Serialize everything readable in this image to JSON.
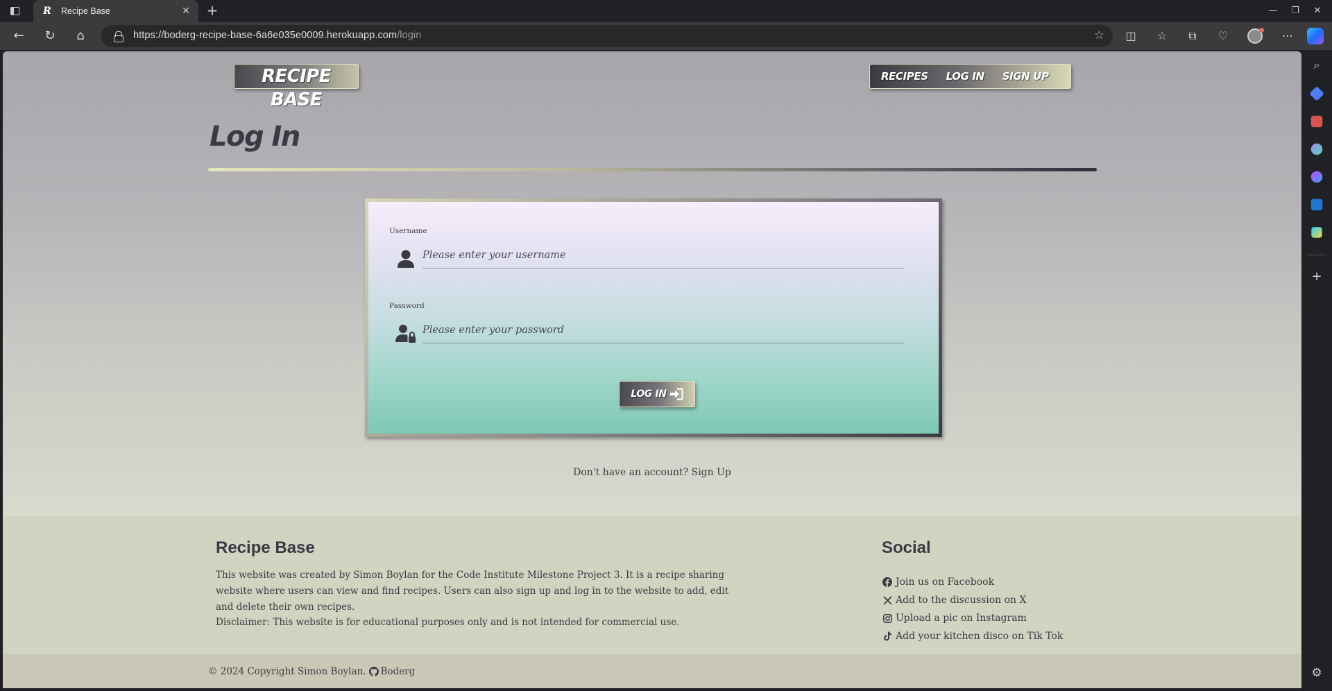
{
  "browser": {
    "tab_title": "Recipe Base",
    "tab_favicon": "R",
    "url_host": "https://boderg-recipe-base-6a6e035e0009.herokuapp.com",
    "url_path": "/login"
  },
  "site": {
    "logo": "RECIPE BASE",
    "nav": [
      {
        "label": "RECIPES"
      },
      {
        "label": "LOG IN"
      },
      {
        "label": "SIGN UP"
      }
    ]
  },
  "page": {
    "title": "Log In"
  },
  "form": {
    "username_label": "Username",
    "username_placeholder": "Please enter your username",
    "username_value": "",
    "password_label": "Password",
    "password_placeholder": "Please enter your password",
    "password_value": "",
    "submit_label": "LOG IN",
    "submit_icon": "sign-in-icon"
  },
  "signup": {
    "prompt": "Don't have an account?",
    "link": "Sign Up"
  },
  "footer": {
    "about_heading": "Recipe Base",
    "about_text": "This website was created by Simon Boylan for the Code Institute Milestone Project 3. It is a recipe sharing website where users can view and find recipes. Users can also sign up and log in to the website to add, edit and delete their own recipes.",
    "disclaimer": "Disclaimer: This website is for educational purposes only and is not intended for commercial use.",
    "social_heading": "Social",
    "social": [
      {
        "label": "Join us on Facebook",
        "icon": "facebook-icon"
      },
      {
        "label": "Add to the discussion on X",
        "icon": "x-icon"
      },
      {
        "label": "Upload a pic on Instagram",
        "icon": "instagram-icon"
      },
      {
        "label": "Add your kitchen disco on Tik Tok",
        "icon": "tiktok-icon"
      }
    ],
    "copyright": "© 2024 Copyright Simon Boylan.",
    "github_label": "Boderg"
  },
  "colors": {
    "text_dark": "#3b3a44",
    "footer_bg": "#d3d3c2",
    "card_top": "#f6eefc",
    "card_bottom": "#7ec8b3"
  }
}
